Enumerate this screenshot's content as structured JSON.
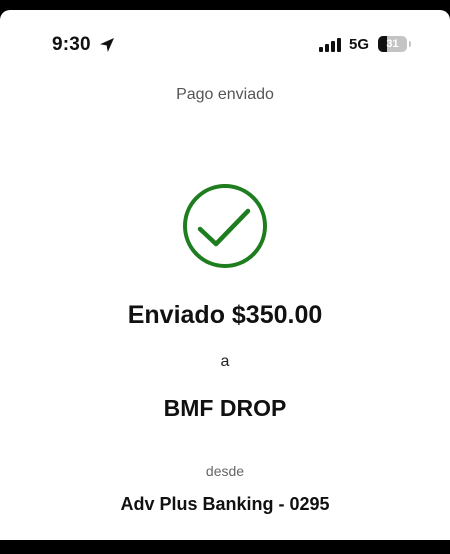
{
  "status_bar": {
    "time": "9:30",
    "network": "5G",
    "battery_level": "31",
    "battery_fraction": 0.31,
    "icons": [
      "location-arrow-icon",
      "cellular-signal-icon",
      "battery-icon"
    ]
  },
  "header": {
    "title": "Pago enviado"
  },
  "confirmation": {
    "icon": "checkmark-circle-icon",
    "icon_color": "#1e7d1e",
    "amount_text": "Enviado $350.00",
    "connector": "a",
    "recipient": "BMF DROP",
    "from_label": "desde",
    "account": "Adv Plus Banking - 0295"
  }
}
